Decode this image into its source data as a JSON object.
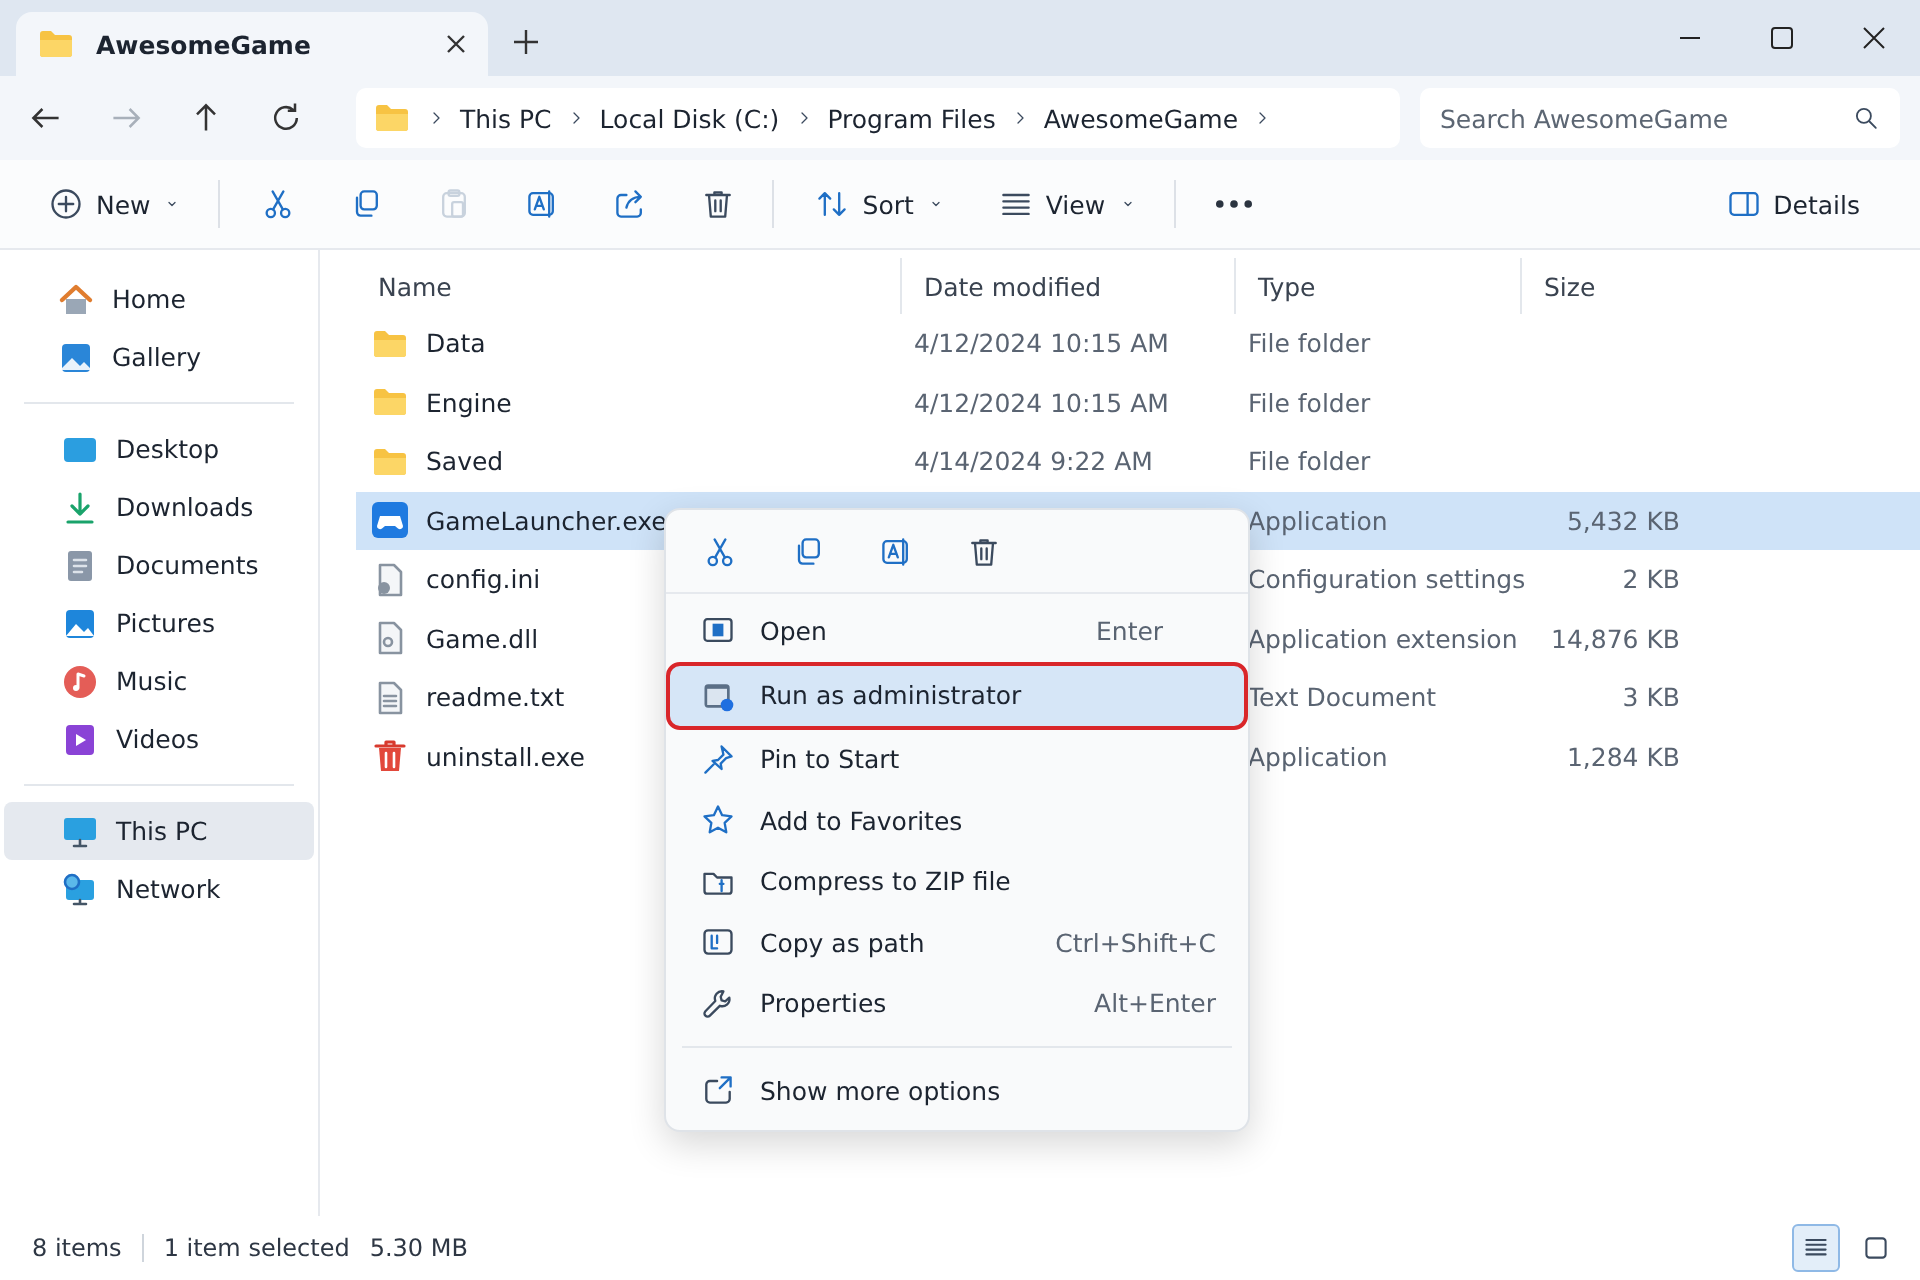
{
  "window": {
    "tabs": [
      {
        "label": "AwesomeGame",
        "selected": true
      }
    ]
  },
  "address": {
    "crumbs": [
      "This PC",
      "Local Disk (C:)",
      "Program Files",
      "AwesomeGame"
    ],
    "search": {
      "placeholder": "Search AwesomeGame"
    }
  },
  "toolbar": {
    "items": [
      {
        "kind": "new",
        "label": "New",
        "has_menu": true,
        "disabled": false
      },
      {
        "kind": "cut",
        "disabled": false
      },
      {
        "kind": "copy",
        "disabled": false
      },
      {
        "kind": "paste",
        "disabled": true
      },
      {
        "kind": "rename",
        "disabled": false
      },
      {
        "kind": "share",
        "disabled": false
      },
      {
        "kind": "delete",
        "disabled": false
      },
      {
        "kind": "sort",
        "label": "Sort",
        "has_menu": true,
        "disabled": false
      },
      {
        "kind": "view",
        "label": "View",
        "has_menu": true,
        "disabled": false
      },
      {
        "kind": "more",
        "disabled": false
      }
    ],
    "details": "Details"
  },
  "sidebar": {
    "groups": [
      [
        {
          "kind": "home",
          "label": "Home",
          "selected": false
        },
        {
          "kind": "gallery",
          "label": "Gallery",
          "selected": false
        }
      ],
      [
        {
          "kind": "desktop",
          "label": "Desktop",
          "selected": false
        },
        {
          "kind": "downloads",
          "label": "Downloads",
          "selected": false
        },
        {
          "kind": "documents",
          "label": "Documents",
          "selected": false
        },
        {
          "kind": "pictures",
          "label": "Pictures",
          "selected": false
        },
        {
          "kind": "music",
          "label": "Music",
          "selected": false
        },
        {
          "kind": "videos",
          "label": "Videos",
          "selected": false
        }
      ],
      [
        {
          "kind": "pc",
          "label": "This PC",
          "selected": true
        },
        {
          "kind": "network",
          "label": "Network",
          "selected": false
        }
      ]
    ]
  },
  "table": {
    "columns": [
      "Name",
      "Date modified",
      "Type",
      "Size"
    ],
    "rows": [
      {
        "kind": "folder",
        "name": "Data",
        "date": "4/12/2024 10:15 AM",
        "type": "File folder",
        "selected": false
      },
      {
        "kind": "folder",
        "name": "Engine",
        "date": "4/12/2024 10:15 AM",
        "type": "File folder",
        "selected": false
      },
      {
        "kind": "folder",
        "name": "Saved",
        "date": "4/14/2024 9:22 AM",
        "type": "File folder",
        "selected": false
      },
      {
        "kind": "game",
        "name": "GameLauncher.exe",
        "type": "Application",
        "size": "5,432 KB",
        "selected": true
      },
      {
        "kind": "settings",
        "name": "config.ini",
        "type": "Configuration settings",
        "size": "2 KB",
        "selected": false
      },
      {
        "kind": "dll",
        "name": "Game.dll",
        "type": "Application extension",
        "size": "14,876 KB",
        "selected": false
      },
      {
        "kind": "text",
        "name": "readme.txt",
        "type": "Text Document",
        "size": "3 KB",
        "selected": false
      },
      {
        "kind": "uninstall",
        "name": "uninstall.exe",
        "type": "Application",
        "size": "1,284 KB",
        "selected": false
      }
    ]
  },
  "context_menu": {
    "quick_actions": [
      {
        "kind": "cut"
      },
      {
        "kind": "copy"
      },
      {
        "kind": "rename"
      },
      {
        "kind": "delete"
      }
    ],
    "items": [
      {
        "kind": "open",
        "label": "Open",
        "shortcut": "Enter",
        "selected": false
      },
      {
        "kind": "admin",
        "label": "Run as administrator",
        "selected": true
      },
      {
        "kind": "pin",
        "label": "Pin to Start",
        "selected": false
      },
      {
        "kind": "favorite",
        "label": "Add to Favorites",
        "selected": false
      },
      {
        "kind": "zip",
        "label": "Compress to ZIP file",
        "selected": false
      },
      {
        "kind": "path",
        "label": "Copy as path",
        "shortcut": "Ctrl+Shift+C",
        "selected": false
      },
      {
        "kind": "properties",
        "label": "Properties",
        "shortcut": "Alt+Enter",
        "selected": false
      }
    ],
    "more": {
      "kind": "show-more",
      "label": "Show more options"
    }
  },
  "status_bar": {
    "count": "8 items",
    "selection": "1 item selected",
    "size": "5.30 MB",
    "views": [
      {
        "kind": "details",
        "selected": true
      },
      {
        "kind": "tiles",
        "selected": false
      }
    ]
  }
}
